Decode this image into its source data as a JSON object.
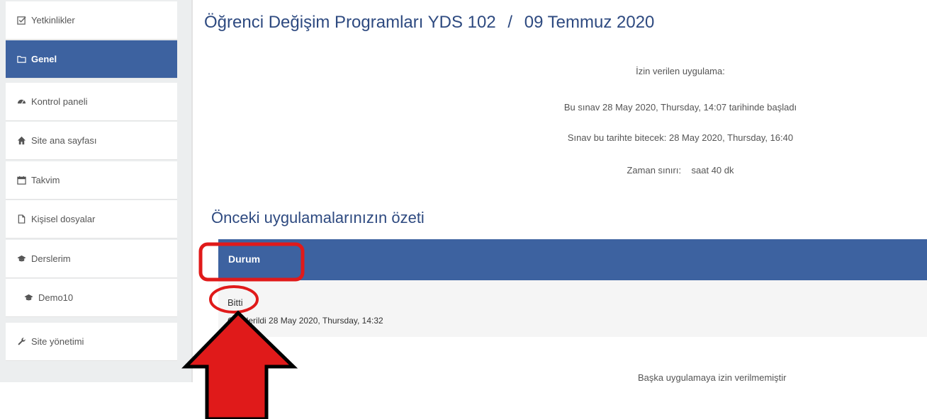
{
  "sidebar": {
    "items": [
      {
        "label": "Yetkinlikler",
        "icon": "checkbox-icon",
        "active": false
      },
      {
        "label": "Genel",
        "icon": "folder-icon",
        "active": true
      },
      {
        "label": "Kontrol paneli",
        "icon": "dashboard-icon",
        "active": false
      },
      {
        "label": "Site ana sayfası",
        "icon": "home-icon",
        "active": false
      },
      {
        "label": "Takvim",
        "icon": "calendar-icon",
        "active": false
      },
      {
        "label": "Kişisel dosyalar",
        "icon": "file-icon",
        "active": false
      },
      {
        "label": "Derslerim",
        "icon": "graduation-cap-icon",
        "active": false
      },
      {
        "label": "Demo10",
        "icon": "graduation-cap-icon",
        "active": false
      },
      {
        "label": "Site yönetimi",
        "icon": "wrench-icon",
        "active": false
      }
    ]
  },
  "page": {
    "title_course": "Öğrenci Değişim Programları YDS 102",
    "title_sep": "/",
    "title_date": "09 Temmuz 2020"
  },
  "info": {
    "allowed_attempts": "İzin verilen uygulama:",
    "started": "Bu sınav 28 May 2020, Thursday, 14:07 tarihinde başladı",
    "ends": "Sınav bu tarihte bitecek: 28 May 2020, Thursday, 16:40",
    "time_limit": "Zaman sınırı:    saat 40 dk"
  },
  "summary": {
    "heading": "Önceki uygulamalarınızın özeti",
    "column_status": "Durum",
    "status_value": "Bitti",
    "submitted": "Gönderildi 28 May 2020, Thursday, 14:32"
  },
  "footer_note": "Başka uygulamaya izin verilmemiştir",
  "colors": {
    "primary": "#3d62a0",
    "title": "#2e4a80",
    "annotation": "#e01a1a"
  }
}
